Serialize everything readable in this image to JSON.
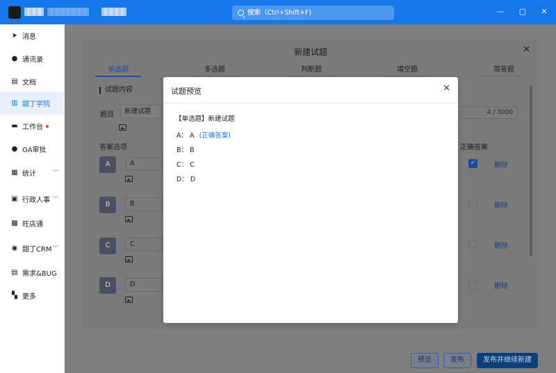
{
  "titlebar": {
    "search_placeholder": "搜索（Ctrl+Shift+F)",
    "minimize": "—",
    "restore": "▢",
    "close": "✕"
  },
  "sidebar": {
    "items": [
      {
        "label": "消息",
        "icon": "send-icon"
      },
      {
        "label": "通讯录",
        "icon": "person-icon"
      },
      {
        "label": "文档",
        "icon": "document-icon"
      },
      {
        "label": "甜丁学院",
        "icon": "books-icon",
        "active": true
      },
      {
        "label": "工作台",
        "icon": "monitor-icon",
        "dot": true
      },
      {
        "label": "OA审批",
        "icon": "person-icon"
      },
      {
        "label": "统计",
        "icon": "chart-icon",
        "chevron": true
      },
      {
        "label": "行政人事",
        "icon": "folder-icon",
        "chevron": true
      },
      {
        "label": "旺店通",
        "icon": "shop-icon"
      },
      {
        "label": "甜丁CRM",
        "icon": "crm-icon",
        "chevron": true
      },
      {
        "label": "需求&BUG",
        "icon": "clipboard-icon"
      },
      {
        "label": "更多",
        "icon": "grid-icon"
      }
    ]
  },
  "form": {
    "title": "新建试题",
    "tabs": [
      "单选题",
      "多选题",
      "判断题",
      "填空题",
      "简答题"
    ],
    "section_title": "试题内容",
    "question_label": "题目",
    "question_value": "新建试题",
    "counter": "4 / 3000",
    "options_label": "答案选项",
    "correct_label": "正确答案",
    "options": [
      {
        "letter": "A",
        "value": "A",
        "correct": true
      },
      {
        "letter": "B",
        "value": "B",
        "correct": false
      },
      {
        "letter": "C",
        "value": "C",
        "correct": false
      },
      {
        "letter": "D",
        "value": "D",
        "correct": false
      }
    ],
    "delete_label": "删除",
    "buttons": {
      "preview": "预览",
      "publish": "发布",
      "publish_continue": "发布并继续新建"
    }
  },
  "modal": {
    "title": "试题预览",
    "question": "【单选题】新建试题",
    "options": [
      {
        "prefix": "A：",
        "value": "A",
        "note": "(正确答案)"
      },
      {
        "prefix": "B：",
        "value": "B",
        "note": ""
      },
      {
        "prefix": "C：",
        "value": "C",
        "note": ""
      },
      {
        "prefix": "D：",
        "value": "D",
        "note": ""
      }
    ]
  },
  "colors": {
    "accent": "#1677e8",
    "titlebar": "#1677e8",
    "overlay": "#7f7f7f"
  }
}
